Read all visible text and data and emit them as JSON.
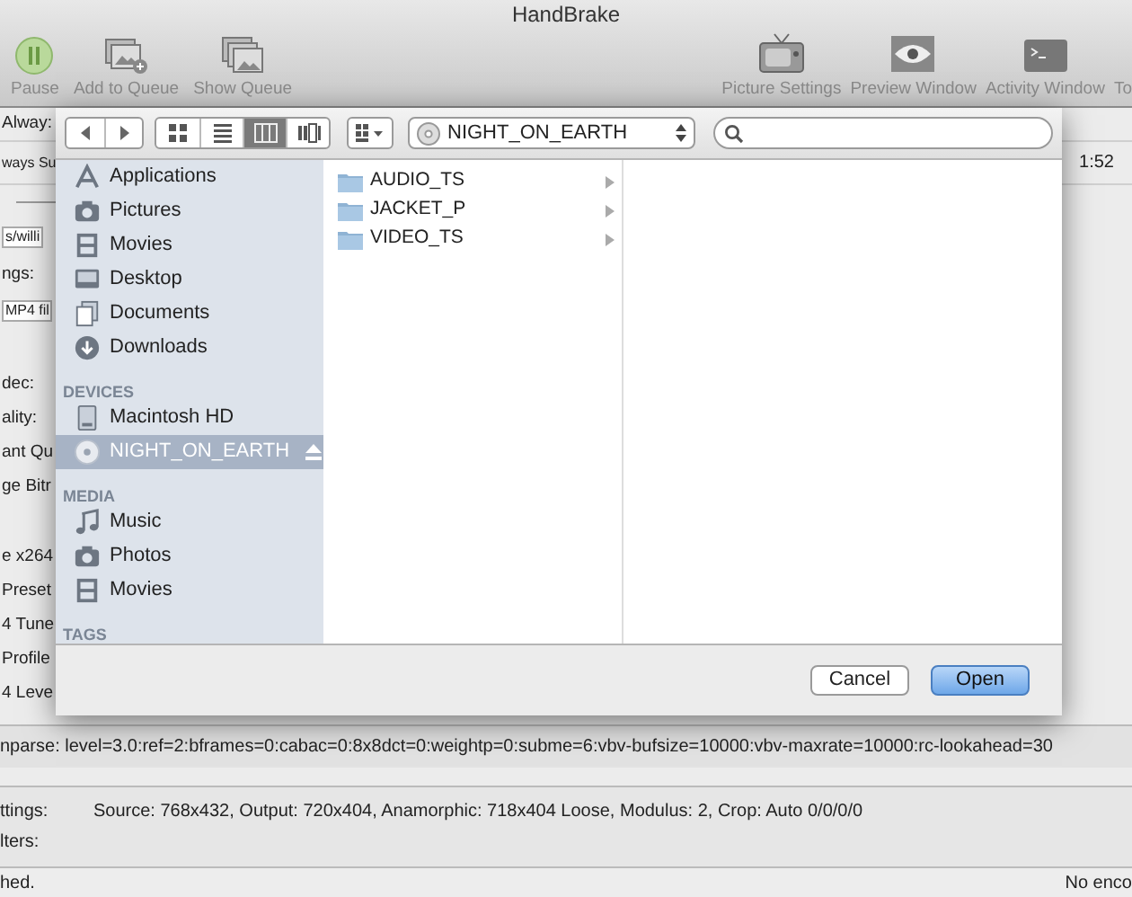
{
  "window": {
    "title": "HandBrake"
  },
  "toolbar": {
    "left": [
      {
        "label": "Pause"
      },
      {
        "label": "Add to Queue"
      },
      {
        "label": "Show Queue"
      }
    ],
    "right": [
      {
        "label": "Picture Settings"
      },
      {
        "label": "Preview Window"
      },
      {
        "label": "Activity Window"
      },
      {
        "label": "To"
      }
    ]
  },
  "background_rows": [
    {
      "kind": "label",
      "text": "Alway:"
    },
    {
      "kind": "small",
      "text": "ways Su",
      "right": "1:52"
    },
    {
      "kind": "line"
    },
    {
      "kind": "field",
      "text": "s/willi"
    },
    {
      "kind": "label",
      "text": "ngs:"
    },
    {
      "kind": "field",
      "text": "MP4 fil"
    },
    {
      "kind": "gap"
    },
    {
      "kind": "label",
      "text": "dec:"
    },
    {
      "kind": "label",
      "text": "ality:"
    },
    {
      "kind": "label",
      "text": "ant Qu"
    },
    {
      "kind": "label",
      "text": "ge Bitr"
    },
    {
      "kind": "gap"
    },
    {
      "kind": "label",
      "text": "e x264"
    },
    {
      "kind": "label",
      "text": "Preset"
    },
    {
      "kind": "label",
      "text": "4 Tune"
    },
    {
      "kind": "label",
      "text": "Profile"
    },
    {
      "kind": "label",
      "text": "4 Leve"
    }
  ],
  "options_line": "nparse: level=3.0:ref=2:bframes=0:cabac=0:8x8dct=0:weightp=0:subme=6:vbv-bufsize=10000:vbv-maxrate=10000:rc-lookahead=30",
  "settings": [
    {
      "label": "ttings:",
      "value": "Source: 768x432, Output: 720x404, Anamorphic: 718x404 Loose, Modulus: 2, Crop: Auto 0/0/0/0"
    },
    {
      "label": "lters:"
    }
  ],
  "status_bar": {
    "left": "hed.",
    "right": "No enco"
  },
  "open_dialog": {
    "view_modes": [
      {
        "selected": false
      },
      {
        "selected": false
      },
      {
        "selected": true
      },
      {
        "selected": false
      }
    ],
    "location": "NIGHT_ON_EARTH",
    "sidebar": [
      {
        "kind": "item",
        "label": "Applications",
        "selected": false,
        "eject": false
      },
      {
        "kind": "item",
        "label": "Pictures",
        "selected": false,
        "eject": false
      },
      {
        "kind": "item",
        "label": "Movies",
        "selected": false,
        "eject": false
      },
      {
        "kind": "item",
        "label": "Desktop",
        "selected": false,
        "eject": false
      },
      {
        "kind": "item",
        "label": "Documents",
        "selected": false,
        "eject": false
      },
      {
        "kind": "item",
        "label": "Downloads",
        "selected": false,
        "eject": false
      },
      {
        "kind": "header",
        "label": "DEVICES"
      },
      {
        "kind": "item",
        "label": "Macintosh HD",
        "selected": false,
        "eject": false
      },
      {
        "kind": "item",
        "label": "NIGHT_ON_EARTH",
        "selected": true,
        "eject": true
      },
      {
        "kind": "header",
        "label": "MEDIA"
      },
      {
        "kind": "item",
        "label": "Music",
        "selected": false,
        "eject": false
      },
      {
        "kind": "item",
        "label": "Photos",
        "selected": false,
        "eject": false
      },
      {
        "kind": "item",
        "label": "Movies",
        "selected": false,
        "eject": false
      },
      {
        "kind": "header",
        "label": "TAGS"
      }
    ],
    "files": [
      {
        "name": "AUDIO_TS",
        "selected": false
      },
      {
        "name": "JACKET_P",
        "selected": false
      },
      {
        "name": "VIDEO_TS",
        "selected": false
      }
    ],
    "buttons": [
      {
        "label": "Cancel",
        "default": false
      },
      {
        "label": "Open",
        "default": true
      }
    ]
  }
}
